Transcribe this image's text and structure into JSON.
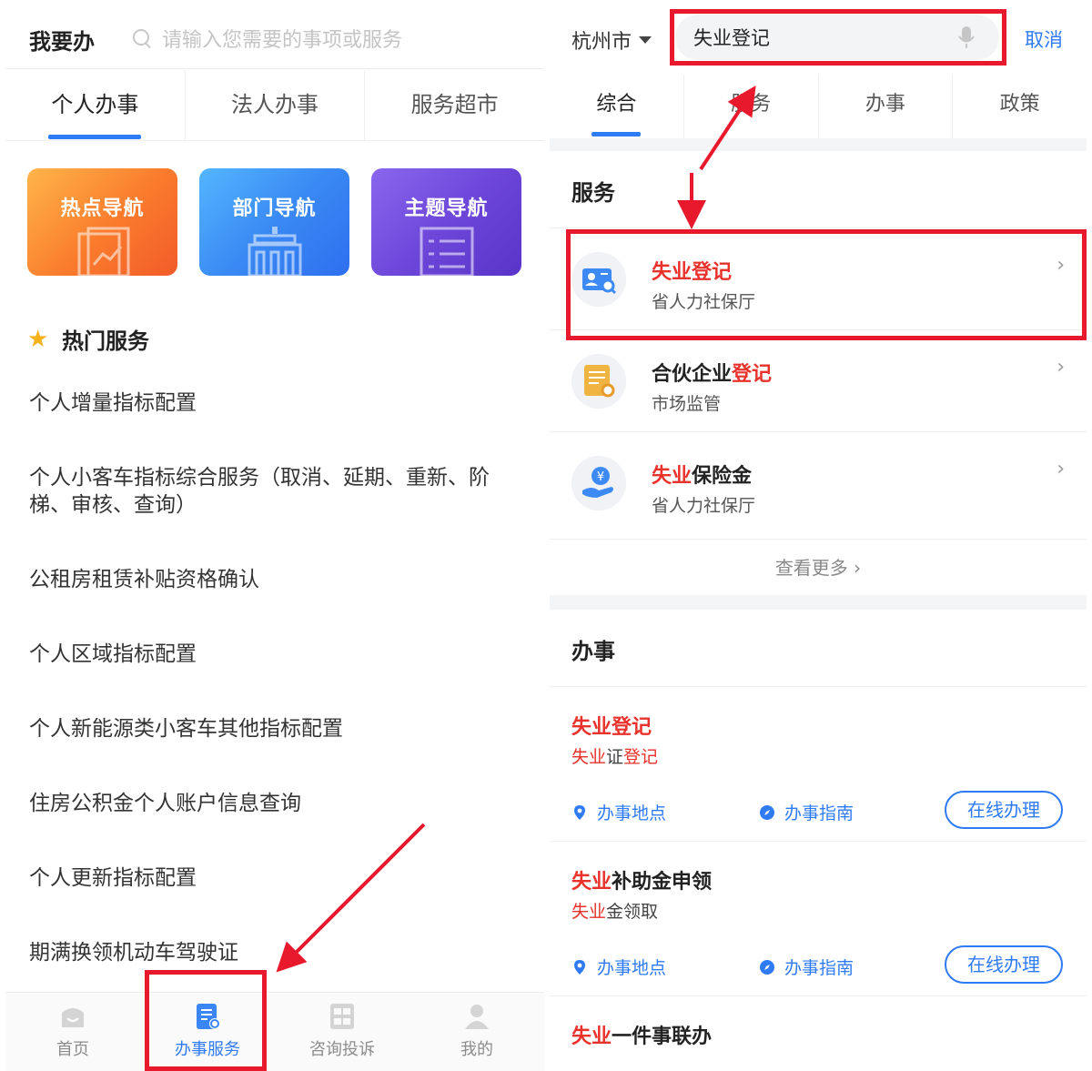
{
  "left": {
    "header": {
      "title": "我要办",
      "search_placeholder": "请输入您需要的事项或服务"
    },
    "tabs": [
      {
        "label": "个人办事",
        "active": true
      },
      {
        "label": "法人办事",
        "active": false
      },
      {
        "label": "服务超市",
        "active": false
      }
    ],
    "nav_cards": [
      {
        "label": "热点导航",
        "icon": "chart-document-icon"
      },
      {
        "label": "部门导航",
        "icon": "building-icon"
      },
      {
        "label": "主题导航",
        "icon": "list-icon"
      }
    ],
    "hot_section_title": "热门服务",
    "hot_items": [
      "个人增量指标配置",
      "个人小客车指标综合服务（取消、延期、重新、阶梯、审核、查询）",
      "公租房租赁补贴资格确认",
      "个人区域指标配置",
      "个人新能源类小客车其他指标配置",
      "住房公积金个人账户信息查询",
      "个人更新指标配置",
      "期满换领机动车驾驶证"
    ],
    "bottom_nav": [
      {
        "label": "首页",
        "icon": "home-icon",
        "active": false
      },
      {
        "label": "办事服务",
        "icon": "service-doc-icon",
        "active": true
      },
      {
        "label": "咨询投诉",
        "icon": "complaint-icon",
        "active": false
      },
      {
        "label": "我的",
        "icon": "user-icon",
        "active": false
      }
    ]
  },
  "right": {
    "header": {
      "city": "杭州市",
      "search_value": "失业登记",
      "cancel_label": "取消"
    },
    "tabs": [
      {
        "label": "综合",
        "active": true
      },
      {
        "label": "服务",
        "active": false
      },
      {
        "label": "办事",
        "active": false
      },
      {
        "label": "政策",
        "active": false
      }
    ],
    "services_title": "服务",
    "services": [
      {
        "title_hl": "失业登记",
        "title_rest": "",
        "dept": "省人力社保厅",
        "icon": "id-search-icon"
      },
      {
        "title_hl": "登记",
        "title_pre": "合伙企业",
        "dept": "市场监管",
        "icon": "certificate-icon"
      },
      {
        "title_hl": "失业",
        "title_rest": "保险金",
        "dept": "省人力社保厅",
        "icon": "yuan-hand-icon"
      }
    ],
    "see_more": "查看更多 ›",
    "tasks_title": "办事",
    "tasks": [
      {
        "title_hl": "失业登记",
        "title_rest": "",
        "sub_hl": "失业",
        "sub_mid": "证",
        "sub_hl2": "登记",
        "location": "办事地点",
        "guide": "办事指南",
        "action": "在线办理"
      },
      {
        "title_hl": "失业",
        "title_rest": "补助金申领",
        "sub_hl": "失业",
        "sub_mid": "金领取",
        "sub_hl2": "",
        "location": "办事地点",
        "guide": "办事指南",
        "action": "在线办理"
      },
      {
        "title_hl": "失业",
        "title_rest": "一件事联办"
      }
    ]
  },
  "colors": {
    "accent": "#2f7bf6",
    "highlight": "#e8322b",
    "annotation": "#e8192c"
  }
}
